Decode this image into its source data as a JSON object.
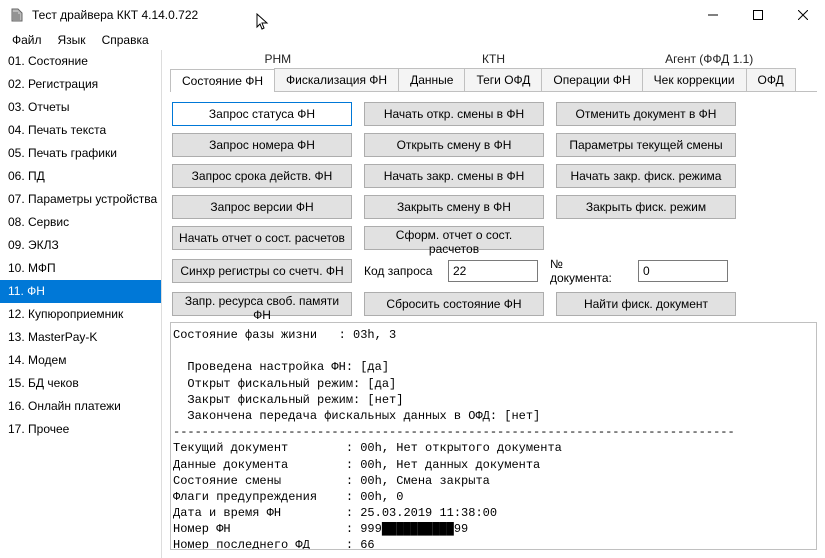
{
  "window": {
    "title": "Тест драйвера ККТ 4.14.0.722"
  },
  "menubar": [
    "Файл",
    "Язык",
    "Справка"
  ],
  "sidebar": {
    "items": [
      {
        "label": "01. Состояние"
      },
      {
        "label": "02. Регистрация"
      },
      {
        "label": "03. Отчеты"
      },
      {
        "label": "04. Печать текста"
      },
      {
        "label": "05. Печать графики"
      },
      {
        "label": "06. ПД"
      },
      {
        "label": "07. Параметры устройства"
      },
      {
        "label": "08. Сервис"
      },
      {
        "label": "09. ЭКЛЗ"
      },
      {
        "label": "10. МФП"
      },
      {
        "label": "11. ФН"
      },
      {
        "label": "12. Купюроприемник"
      },
      {
        "label": "13. MasterPay-K"
      },
      {
        "label": "14. Модем"
      },
      {
        "label": "15. БД чеков"
      },
      {
        "label": "16. Онлайн платежи"
      },
      {
        "label": "17. Прочее"
      }
    ],
    "activeIndex": 10
  },
  "tabGroups": [
    "РНМ",
    "КТН",
    "Агент (ФФД 1.1)"
  ],
  "tabs": {
    "items": [
      "Состояние ФН",
      "Фискализация ФН",
      "Данные",
      "Теги ОФД",
      "Операции ФН",
      "Чек коррекции",
      "ОФД"
    ],
    "activeIndex": 0
  },
  "buttons": {
    "r0c0": "Запрос статуса ФН",
    "r0c1": "Начать откр. смены в ФН",
    "r0c2": "Отменить документ в ФН",
    "r1c0": "Запрос номера ФН",
    "r1c1": "Открыть смену в ФН",
    "r1c2": "Параметры текущей смены",
    "r2c0": "Запрос срока действ. ФН",
    "r2c1": "Начать закр. смены в ФН",
    "r2c2": "Начать закр. фиск. режима",
    "r3c0": "Запрос версии ФН",
    "r3c1": "Закрыть смену в ФН",
    "r3c2": "Закрыть фиск. режим",
    "r4c0": "Начать отчет о сост. расчетов",
    "r4c1": "Сформ. отчет о сост. расчетов",
    "r5c0": "Синхр регистры со счетч. ФН",
    "r6c0": "Запр. ресурса своб. памяти ФН",
    "r6c1": "Сбросить состояние ФН",
    "r6c2": "Найти фиск. документ"
  },
  "fields": {
    "code_label": "Код запроса",
    "code_value": "22",
    "doc_label": "№ документа:",
    "doc_value": "0"
  },
  "output": "Состояние фазы жизни   : 03h, 3\n\n  Проведена настройка ФН: [да]\n  Открыт фискальный режим: [да]\n  Закрыт фискальный режим: [нет]\n  Закончена передача фискальных данных в ОФД: [нет]\n------------------------------------------------------------------------------\nТекущий документ        : 00h, Нет открытого документа\nДанные документа        : 00h, Нет данных документа\nСостояние смены         : 00h, Смена закрыта\nФлаги предупреждения    : 00h, 0\nДата и время ФН         : 25.03.2019 11:38:00\nНомер ФН                : 999██████████99\nНомер последнего ФД     : 66"
}
